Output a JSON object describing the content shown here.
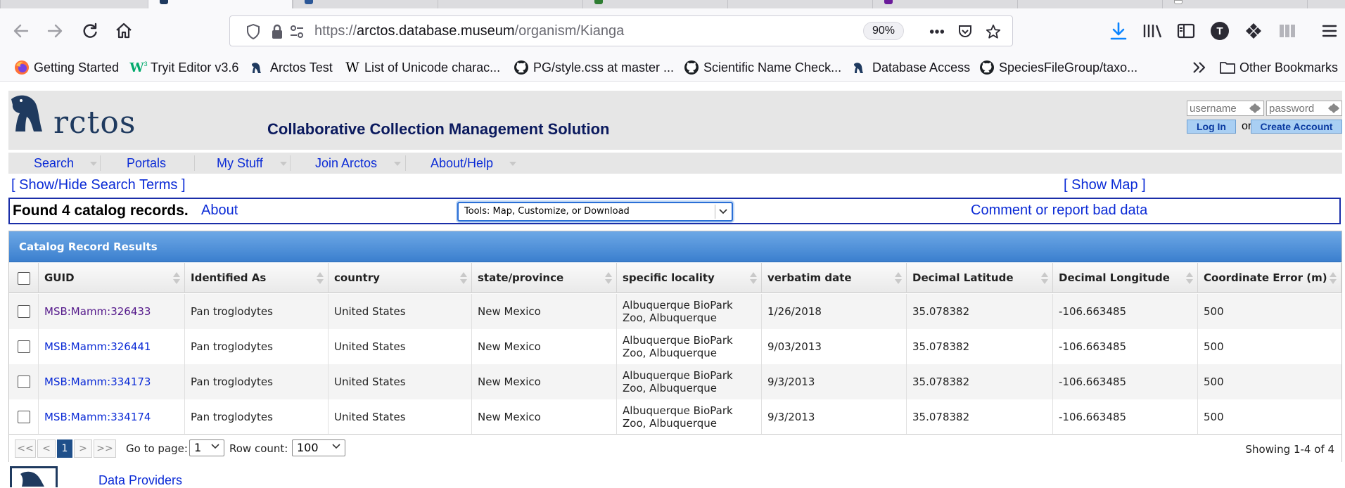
{
  "browser": {
    "url_prefix": "https://",
    "url_domain": "arctos.database.museum",
    "url_path": "/organism/Kianga",
    "zoom": "90%",
    "profile_initial": "T",
    "bookmarks": [
      {
        "label": "Getting Started",
        "icon": "firefox-icon"
      },
      {
        "label": "Tryit Editor v3.6",
        "icon": "w3schools-icon"
      },
      {
        "label": "Arctos Test",
        "icon": "arctos-bear-icon"
      },
      {
        "label": "List of Unicode charac...",
        "icon": "wikipedia-icon"
      },
      {
        "label": "PG/style.css at master ...",
        "icon": "github-icon"
      },
      {
        "label": "Scientific Name Check...",
        "icon": "github-icon"
      },
      {
        "label": "Database Access",
        "icon": "arctos-bear-icon"
      },
      {
        "label": "SpeciesFileGroup/taxo...",
        "icon": "github-icon"
      }
    ],
    "other_bookmarks": "Other Bookmarks"
  },
  "header": {
    "logo_text": "rctos",
    "tagline": "Collaborative Collection Management Solution",
    "username_placeholder": "username",
    "password_placeholder": "password",
    "login_label": "Log In",
    "or_label": "or",
    "create_account_label": "Create Account"
  },
  "menu": [
    "Search",
    "Portals",
    "My Stuff",
    "Join Arctos",
    "About/Help"
  ],
  "links": {
    "show_hide_terms": "[ Show/Hide Search Terms ]",
    "show_map": "[ Show Map ]",
    "about": "About",
    "comment": "Comment or report bad data"
  },
  "results": {
    "found_text": "Found 4 catalog records.",
    "tools_value": "Tools: Map, Customize, or Download",
    "caption": "Catalog Record Results",
    "columns": [
      "GUID",
      "Identified As",
      "country",
      "state/province",
      "specific locality",
      "verbatim date",
      "Decimal Latitude",
      "Decimal Longitude",
      "Coordinate Error (m)"
    ],
    "rows": [
      {
        "guid": "MSB:Mamm:326433",
        "identified_as": "Pan troglodytes",
        "country": "United States",
        "state": "New Mexico",
        "locality": "Albuquerque BioPark Zoo, Albuquerque",
        "date": "1/26/2018",
        "lat": "35.078382",
        "lon": "-106.663485",
        "err": "500"
      },
      {
        "guid": "MSB:Mamm:326441",
        "identified_as": "Pan troglodytes",
        "country": "United States",
        "state": "New Mexico",
        "locality": "Albuquerque BioPark Zoo, Albuquerque",
        "date": "9/03/2013",
        "lat": "35.078382",
        "lon": "-106.663485",
        "err": "500"
      },
      {
        "guid": "MSB:Mamm:334173",
        "identified_as": "Pan troglodytes",
        "country": "United States",
        "state": "New Mexico",
        "locality": "Albuquerque BioPark Zoo, Albuquerque",
        "date": "9/3/2013",
        "lat": "35.078382",
        "lon": "-106.663485",
        "err": "500"
      },
      {
        "guid": "MSB:Mamm:334174",
        "identified_as": "Pan troglodytes",
        "country": "United States",
        "state": "New Mexico",
        "locality": "Albuquerque BioPark Zoo, Albuquerque",
        "date": "9/3/2013",
        "lat": "35.078382",
        "lon": "-106.663485",
        "err": "500"
      }
    ],
    "pager": {
      "first": "<<",
      "prev": "<",
      "current": "1",
      "next": ">",
      "last": ">>",
      "goto_label": "Go to page:",
      "goto_value": "1",
      "rowcount_label": "Row count:",
      "rowcount_value": "100",
      "showing": "Showing 1-4 of 4"
    }
  },
  "footer": {
    "link": "Data Providers"
  }
}
